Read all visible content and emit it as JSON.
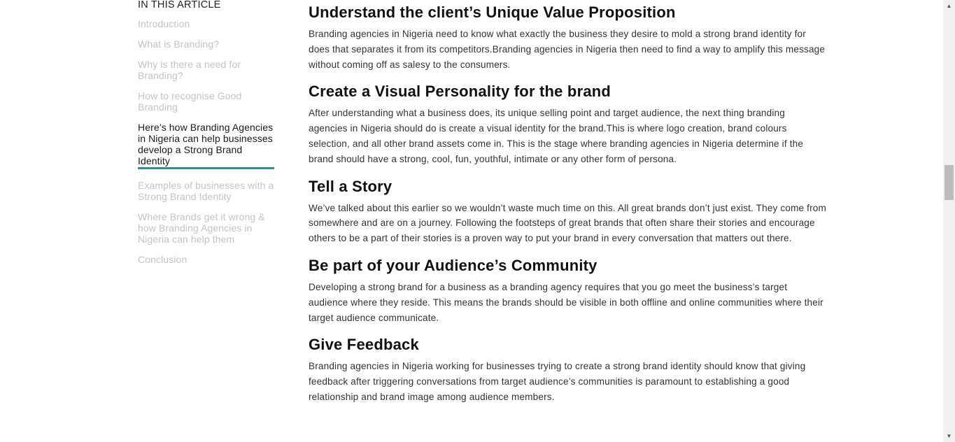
{
  "toc": {
    "title": "IN THIS ARTICLE",
    "items": [
      {
        "label": "Introduction",
        "active": false
      },
      {
        "label": "What is Branding?",
        "active": false
      },
      {
        "label": "Why is there a need for Branding?",
        "active": false
      },
      {
        "label": "How to recognise Good Branding",
        "active": false
      },
      {
        "label": "Here’s how Branding Agencies in Nigeria can help businesses develop a Strong Brand Identity",
        "active": true
      },
      {
        "label": "Examples of businesses with a Strong Brand Identity",
        "active": false
      },
      {
        "label": "Where Brands get it wrong & how Branding Agencies in Nigeria can help them",
        "active": false
      },
      {
        "label": "Conclusion",
        "active": false
      }
    ],
    "active_color": "#189aa0"
  },
  "article": {
    "sections": [
      {
        "heading": "Understand the client’s Unique Value Proposition",
        "body": "Branding agencies in Nigeria need to know what exactly the business they desire to mold a strong brand identity for does that separates it from its competitors.Branding agencies in Nigeria then need to find a way to amplify this message without coming off as salesy to the consumers."
      },
      {
        "heading": "Create a Visual Personality for the brand",
        "body": "After understanding what a business does, its unique selling point and target audience, the next thing branding agencies in Nigeria should do is create a visual identity for the brand.This is where logo creation, brand colours selection, and all other brand assets come in.  This is the stage where branding agencies in Nigeria determine if the brand should have a strong, cool, fun, youthful, intimate or any other form of persona."
      },
      {
        "heading": "Tell a Story",
        "body": "We’ve talked about this earlier so we wouldn’t waste much time on this. All great brands don’t just exist. They come from somewhere and are on a journey. Following the footsteps of great brands that often share their stories and encourage others to be a part of their stories is a proven way to put your brand in every conversation that matters out there."
      },
      {
        "heading": "Be part of your Audience’s Community",
        "body": "Developing a strong brand for a business as a branding agency requires that you go meet the business’s target audience where they reside. This means the brands should be visible in both offline and online communities where their target audience communicate."
      },
      {
        "heading": "Give Feedback",
        "body": "Branding agencies in Nigeria working for businesses trying to create a strong brand identity should know that giving feedback after triggering conversations from target audience’s communities is paramount to establishing a good relationship and brand image among audience members."
      }
    ]
  },
  "scrollbar": {
    "up_icon": "▲",
    "down_icon": "▼",
    "scroll_position_fraction": 0.4
  }
}
